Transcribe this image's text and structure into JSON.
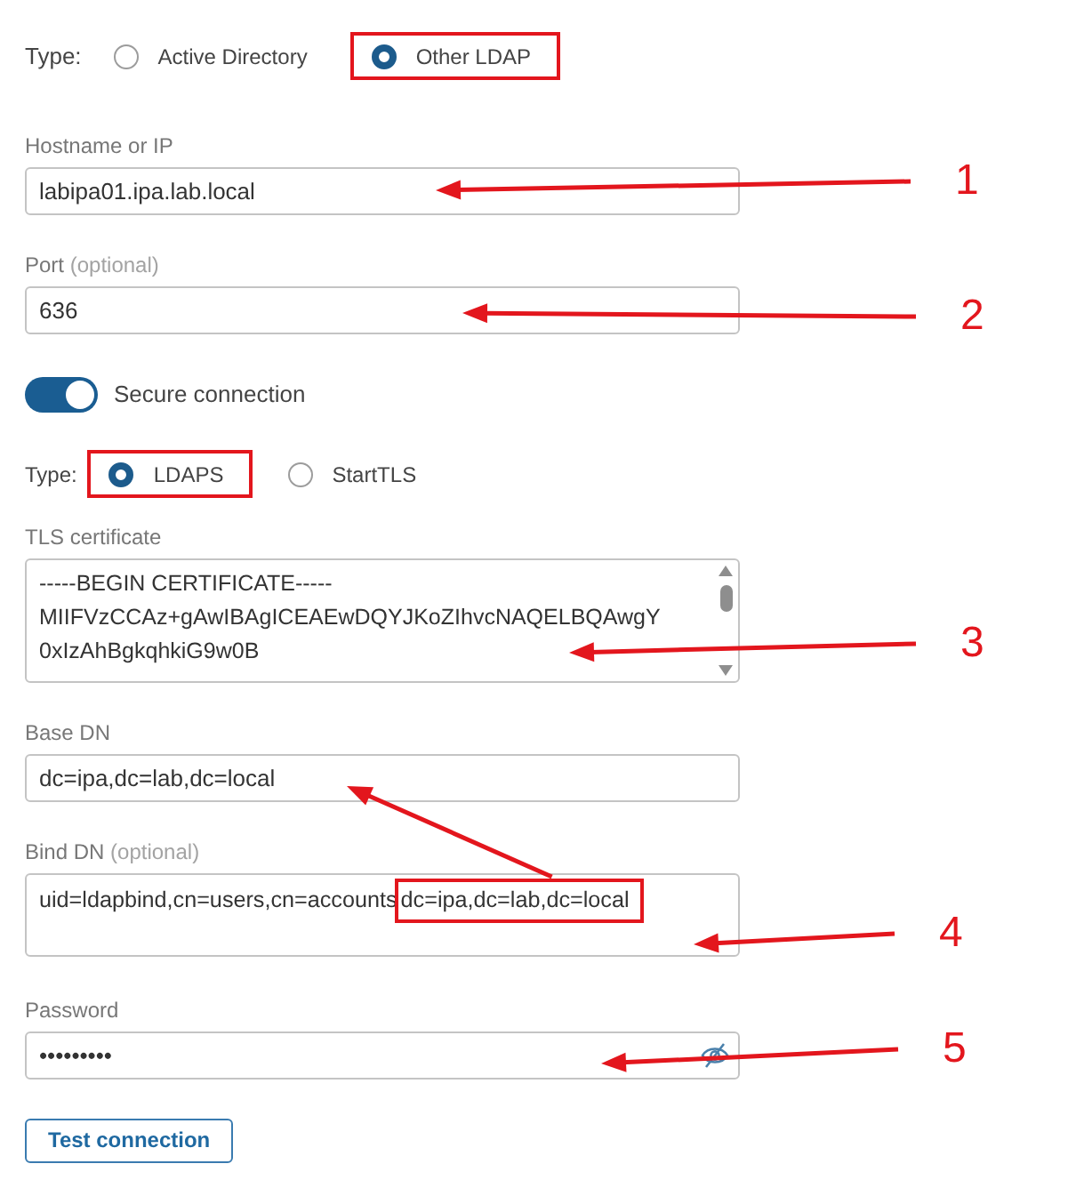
{
  "connection_type": {
    "label": "Type:",
    "options": [
      {
        "label": "Active Directory",
        "selected": false,
        "highlighted": false
      },
      {
        "label": "Other LDAP",
        "selected": true,
        "highlighted": true
      }
    ]
  },
  "hostname": {
    "label": "Hostname or IP",
    "value": "labipa01.ipa.lab.local",
    "callout": "1"
  },
  "port": {
    "label": "Port",
    "hint": "(optional)",
    "value": "636",
    "callout": "2"
  },
  "secure_connection": {
    "label": "Secure connection",
    "on": true
  },
  "tls_type": {
    "label": "Type:",
    "options": [
      {
        "label": "LDAPS",
        "selected": true,
        "highlighted": true
      },
      {
        "label": "StartTLS",
        "selected": false,
        "highlighted": false
      }
    ]
  },
  "tls_certificate": {
    "label": "TLS certificate",
    "lines": [
      "-----BEGIN CERTIFICATE-----",
      "MIIFVzCCAz+gAwIBAgICEAEwDQYJKoZIhvcNAQELBQAwgY",
      "0xIzAhBgkqhkiG9w0B"
    ],
    "callout": "3"
  },
  "base_dn": {
    "label": "Base DN",
    "value": "dc=ipa,dc=lab,dc=local"
  },
  "bind_dn": {
    "label": "Bind DN",
    "hint": "(optional)",
    "segments": [
      {
        "text": "uid=ldapbind,cn=users,cn=accounts",
        "highlighted": false
      },
      {
        "text": "dc=ipa,dc=lab,dc=local",
        "highlighted": true,
        "arrow_to_base_dn": true
      }
    ],
    "callout": "4"
  },
  "password": {
    "label": "Password",
    "value": "•••••••••",
    "callout": "5"
  },
  "buttons": [
    {
      "label": "Test connection"
    }
  ]
}
